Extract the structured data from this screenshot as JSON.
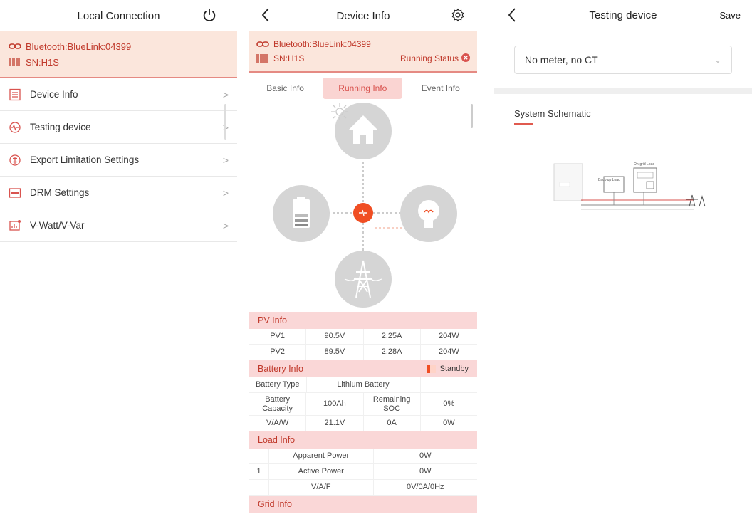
{
  "panel1": {
    "title": "Local Connection",
    "bluetooth": "Bluetooth:BlueLink:04399",
    "sn": "SN:H1S",
    "menu": [
      {
        "label": "Device Info",
        "icon": "device-info-icon"
      },
      {
        "label": "Testing device",
        "icon": "testing-icon"
      },
      {
        "label": "Export Limitation Settings",
        "icon": "export-limit-icon"
      },
      {
        "label": "DRM Settings",
        "icon": "drm-icon"
      },
      {
        "label": "V-Watt/V-Var",
        "icon": "vwatt-icon"
      }
    ]
  },
  "panel2": {
    "title": "Device Info",
    "bluetooth": "Bluetooth:BlueLink:04399",
    "sn": "SN:H1S",
    "running_status": "Running Status",
    "tabs": [
      "Basic Info",
      "Running Info",
      "Event Info"
    ],
    "active_tab": "Running Info",
    "pv": {
      "header": "PV Info",
      "rows": [
        [
          "PV1",
          "90.5V",
          "2.25A",
          "204W"
        ],
        [
          "PV2",
          "89.5V",
          "2.28A",
          "204W"
        ]
      ]
    },
    "battery": {
      "header": "Battery Info",
      "status": "Standby",
      "type_label": "Battery Type",
      "type_value": "Lithium Battery",
      "capacity_label": "Battery Capacity",
      "capacity_value": "100Ah",
      "soc_label": "Remaining SOC",
      "soc_value": "0%",
      "vaw_label": "V/A/W",
      "vaw_values": [
        "21.1V",
        "0A",
        "0W"
      ]
    },
    "load": {
      "header": "Load Info",
      "index": "1",
      "apparent_label": "Apparent Power",
      "apparent_value": "0W",
      "active_label": "Active Power",
      "active_value": "0W",
      "vaf_label": "V/A/F",
      "vaf_value": "0V/0A/0Hz"
    },
    "grid_header": "Grid Info"
  },
  "panel3": {
    "title": "Testing device",
    "save": "Save",
    "meter_option": "No meter, no CT",
    "schematic_title": "System Schematic",
    "backup_load": "Back-up Load",
    "ongrid_load": "On-grid Load"
  },
  "colors": {
    "accent": "#d9534f",
    "header_bg": "#fbe6dc",
    "section_bg": "#fad7d7"
  }
}
